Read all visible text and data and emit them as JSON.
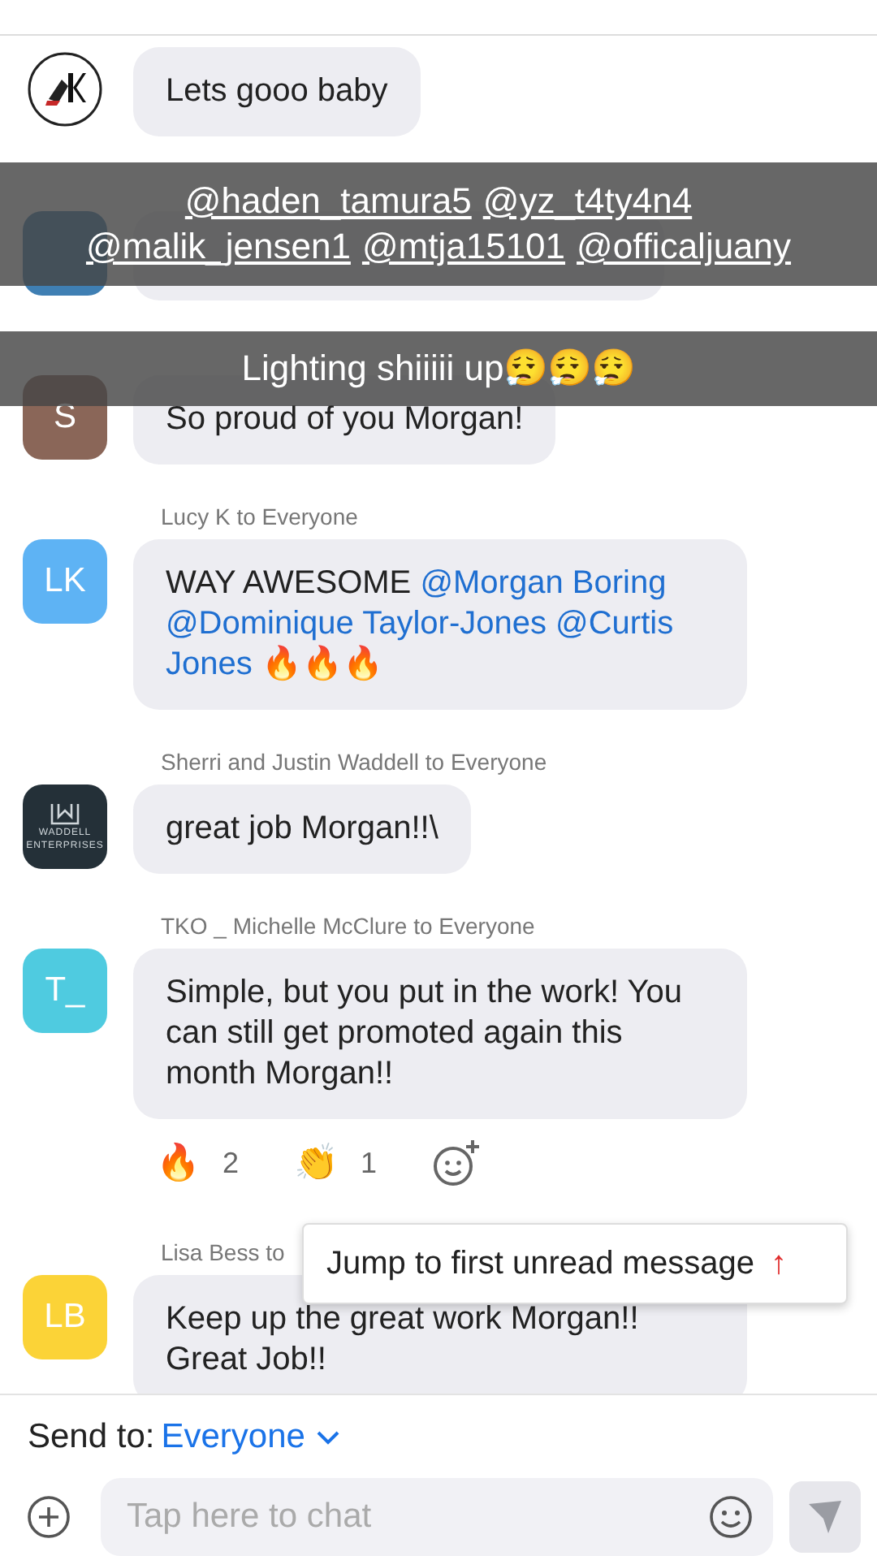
{
  "messages": [
    {
      "avatar": {
        "kind": "logo",
        "color": "#ffffff"
      },
      "text": [
        {
          "kind": "plain",
          "text": "Lets gooo baby"
        }
      ]
    },
    {
      "avatar": {
        "kind": "hidden"
      }
    },
    {
      "avatar": {
        "kind": "initials",
        "initials": "S",
        "color": "#8a6658"
      },
      "text": [
        {
          "kind": "plain",
          "text": "So proud of you Morgan!"
        }
      ]
    },
    {
      "sender": "Lucy K to Everyone",
      "avatar": {
        "kind": "initials",
        "initials": "LK",
        "color": "#5eb3f4"
      },
      "text": [
        {
          "kind": "plain",
          "text": "WAY AWESOME"
        },
        {
          "kind": "mention",
          "text": "@Morgan Boring"
        },
        {
          "kind": "mention",
          "text": "@Dominique Taylor-Jones"
        },
        {
          "kind": "mention",
          "text": "@Curtis"
        },
        {
          "kind": "mention",
          "text": "Jones"
        },
        {
          "kind": "plain",
          "text": "🔥🔥🔥"
        }
      ]
    },
    {
      "sender": "Sherri and Justin Waddell to Everyone",
      "avatar": {
        "kind": "brand",
        "lines": [
          "WADDELL",
          "ENTERPRISES"
        ],
        "color": "#243038"
      },
      "text": [
        {
          "kind": "plain",
          "text": "great job Morgan!!\\"
        }
      ]
    },
    {
      "sender": "TKO _ Michelle McClure to Everyone",
      "avatar": {
        "kind": "initials",
        "initials": "T_",
        "color": "#4fcbe0"
      },
      "text": [
        {
          "kind": "plain",
          "text": "Simple, but you put in the work!  You can still get promoted again this month Morgan!!"
        }
      ],
      "reactions": [
        {
          "emoji": "🔥",
          "count": "2"
        },
        {
          "emoji": "👏",
          "count": "1"
        }
      ]
    },
    {
      "sender": "Lisa Bess to",
      "avatar": {
        "kind": "initials",
        "initials": "LB",
        "color": "#fbd337"
      },
      "text": [
        {
          "kind": "plain",
          "text": "Keep up the great work Morgan!! Great Job!!"
        }
      ]
    }
  ],
  "captions": [
    {
      "kind": "mentions",
      "lines": [
        [
          "@haden_tamura5",
          "@yz_t4ty4n4"
        ],
        [
          "@malik_jensen1",
          "@mtja15101",
          "@officaljuany"
        ]
      ]
    },
    {
      "kind": "text",
      "text": "Lighting shiiiii up😮‍💨😮‍💨😮‍💨"
    }
  ],
  "jump_popup": {
    "label": "Jump to first unread message",
    "arrow": "↑"
  },
  "send_to": {
    "label": "Send to:",
    "value": "Everyone"
  },
  "composer": {
    "placeholder": "Tap here to chat"
  }
}
